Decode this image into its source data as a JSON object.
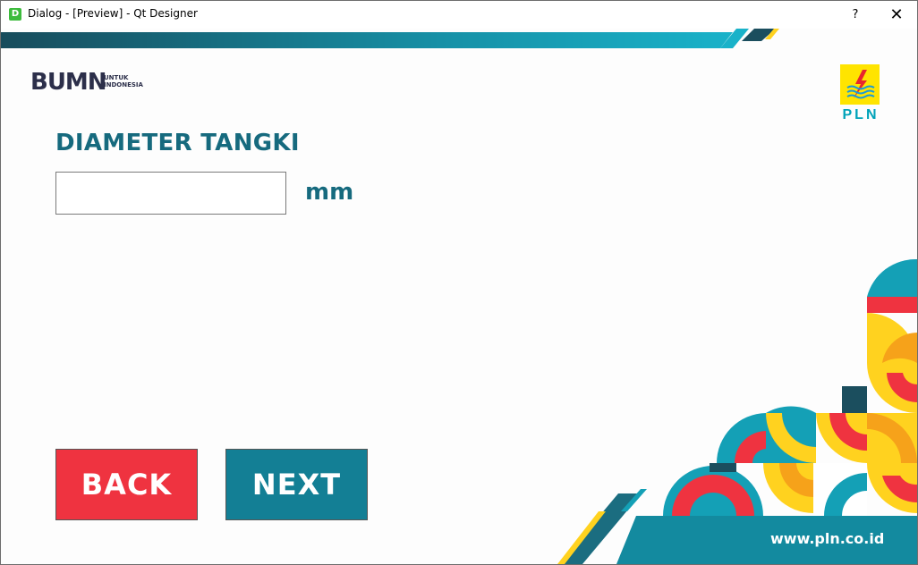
{
  "window": {
    "title": "Dialog - [Preview] - Qt Designer",
    "app_icon_letter": "D",
    "help_label": "?",
    "close_label": "✕"
  },
  "logos": {
    "bumn_text": "BUMN",
    "bumn_sub_1": "UNTUK",
    "bumn_sub_2": "INDONESIA",
    "pln_text": "PLN"
  },
  "form": {
    "label": "DIAMETER TANGKI",
    "input_value": "",
    "unit": "mm"
  },
  "buttons": {
    "back_label": "BACK",
    "next_label": "NEXT"
  },
  "footer": {
    "website": "www.pln.co.id"
  },
  "colors": {
    "teal_dark": "#166a7e",
    "teal": "#14a0b6",
    "red": "#ef3340",
    "yellow": "#ffd21f"
  }
}
